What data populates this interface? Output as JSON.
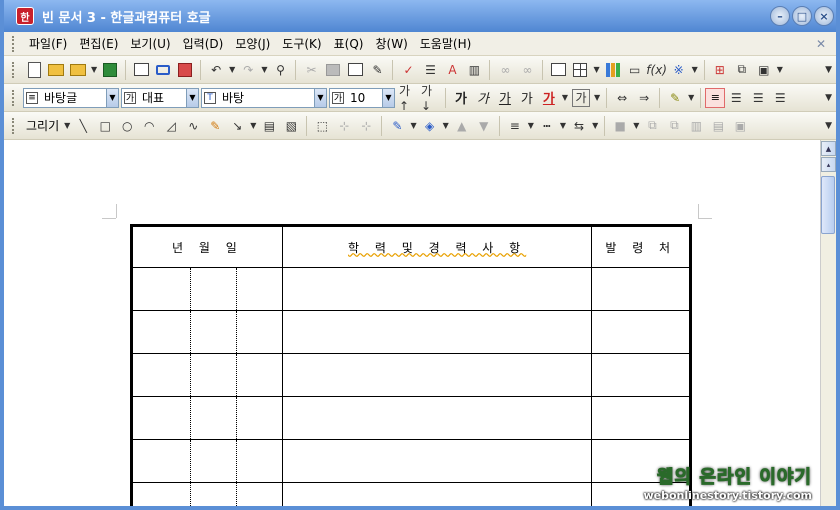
{
  "window": {
    "app_icon": "hwp-icon",
    "app_icon_text": "한",
    "title": "빈 문서 3 - 한글과컴퓨터 호글"
  },
  "menu": [
    "파일(F)",
    "편집(E)",
    "보기(U)",
    "입력(D)",
    "모양(J)",
    "도구(K)",
    "표(Q)",
    "창(W)",
    "도움말(H)"
  ],
  "format_bar": {
    "style": "바탕글",
    "font_lang": "대표",
    "font": "바탕",
    "font_size": "10"
  },
  "draw_bar": {
    "draw_label": "그리기"
  },
  "table": {
    "headers": [
      "년 월 일",
      "학 력 및 경 력 사 항",
      "발 령 처"
    ],
    "rows": 6
  },
  "watermark": {
    "title": "웹의 온라인 이야기",
    "url": "webonlinestory.tistory.com"
  }
}
